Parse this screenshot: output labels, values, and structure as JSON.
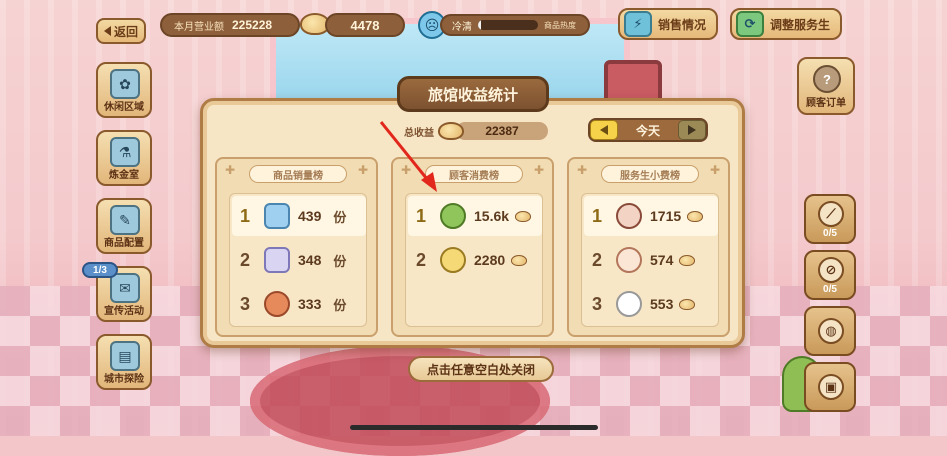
{
  "hud": {
    "back_label": "返回",
    "month_revenue_label": "本月营业额",
    "month_revenue_value": "225228",
    "coins_value": "4478",
    "status_word": "冷清",
    "heat_label": "商品热度",
    "heat_level": 0.05,
    "sales_btn": "销售情况",
    "staff_btn": "调整服务生"
  },
  "left_menu": [
    {
      "label": "休闲区域",
      "icon": "fan-icon"
    },
    {
      "label": "炼金室",
      "icon": "potion-icon"
    },
    {
      "label": "商品配置",
      "icon": "tools-icon"
    },
    {
      "label": "宣传活动",
      "icon": "megaphone-icon",
      "badge": "1/3"
    },
    {
      "label": "城市探险",
      "icon": "book-icon"
    }
  ],
  "right_menu": {
    "orders_label": "顾客订单",
    "slot1_count": "0/5",
    "slot2_count": "0/5"
  },
  "modal": {
    "title": "旅馆收益统计",
    "total_label": "总收益",
    "total_value": "22387",
    "day_label": "今天",
    "close_hint": "点击任意空白处关闭",
    "panels": [
      {
        "title": "商品销量榜",
        "rows": [
          {
            "rank": "1",
            "value": "439",
            "unit": "份",
            "thumb": "blue"
          },
          {
            "rank": "2",
            "value": "348",
            "unit": "份",
            "thumb": "lavender"
          },
          {
            "rank": "3",
            "value": "333",
            "unit": "份",
            "thumb": "pizza"
          }
        ]
      },
      {
        "title": "顾客消费榜",
        "rows": [
          {
            "rank": "1",
            "value": "15.6k",
            "thumb": "green-hood"
          },
          {
            "rank": "2",
            "value": "2280",
            "thumb": "yellow-cat"
          }
        ]
      },
      {
        "title": "服务生小费榜",
        "rows": [
          {
            "rank": "1",
            "value": "1715",
            "thumb": "girl"
          },
          {
            "rank": "2",
            "value": "574",
            "thumb": "cat"
          },
          {
            "rank": "3",
            "value": "553",
            "thumb": "white-cat"
          }
        ]
      }
    ]
  }
}
